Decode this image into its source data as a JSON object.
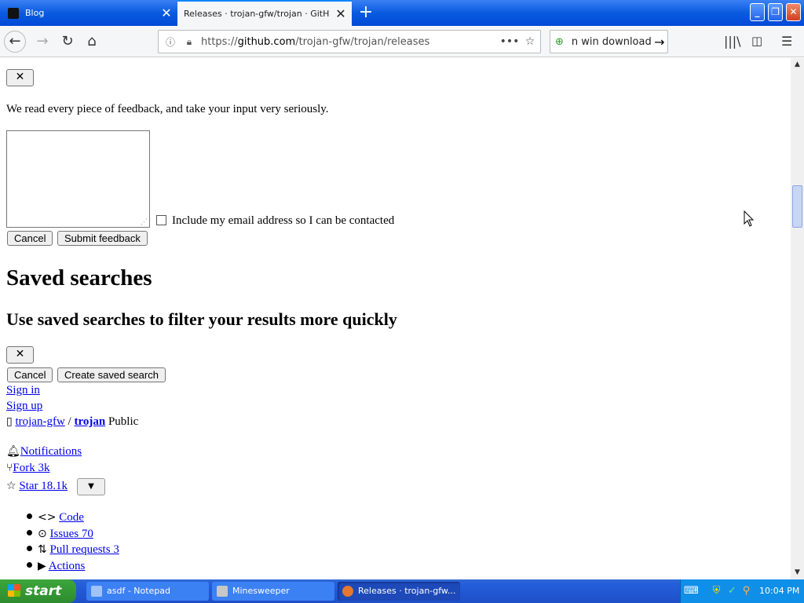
{
  "browser": {
    "tabs": [
      {
        "title": "Blog"
      },
      {
        "title": "Releases · trojan-gfw/trojan · GitHub"
      }
    ],
    "url": {
      "prefix": "https://",
      "host": "github.com",
      "path": "/trojan-gfw/trojan/releases"
    },
    "search_text": "n win download"
  },
  "page": {
    "close_label": "✕",
    "feedback_text": "We read every piece of feedback, and take your input very seriously.",
    "email_label": "Include my email address so I can be contacted",
    "cancel_label": "Cancel",
    "submit_feedback_label": "Submit feedback",
    "saved_searches_title": "Saved searches",
    "saved_searches_subtitle": "Use saved searches to filter your results more quickly",
    "create_saved_search_label": "Create saved search",
    "sign_in": "Sign in",
    "sign_up": "Sign up",
    "repo": {
      "owner": "trojan-gfw",
      "separator": "/",
      "name": "trojan",
      "visibility": "Public"
    },
    "notifications": "Notifications",
    "fork": "Fork 3k",
    "star": "Star 18.1k",
    "tabs": [
      {
        "label": "Code",
        "icon": "code-icon"
      },
      {
        "label": "Issues 70",
        "icon": "issue-icon"
      },
      {
        "label": "Pull requests 3",
        "icon": "pull-request-icon"
      },
      {
        "label": "Actions",
        "icon": "play-icon"
      }
    ]
  },
  "taskbar": {
    "start": "start",
    "tasks": [
      {
        "label": "asdf - Notepad"
      },
      {
        "label": "Minesweeper"
      },
      {
        "label": "Releases · trojan-gfw..."
      }
    ],
    "clock": "10:04 PM"
  }
}
